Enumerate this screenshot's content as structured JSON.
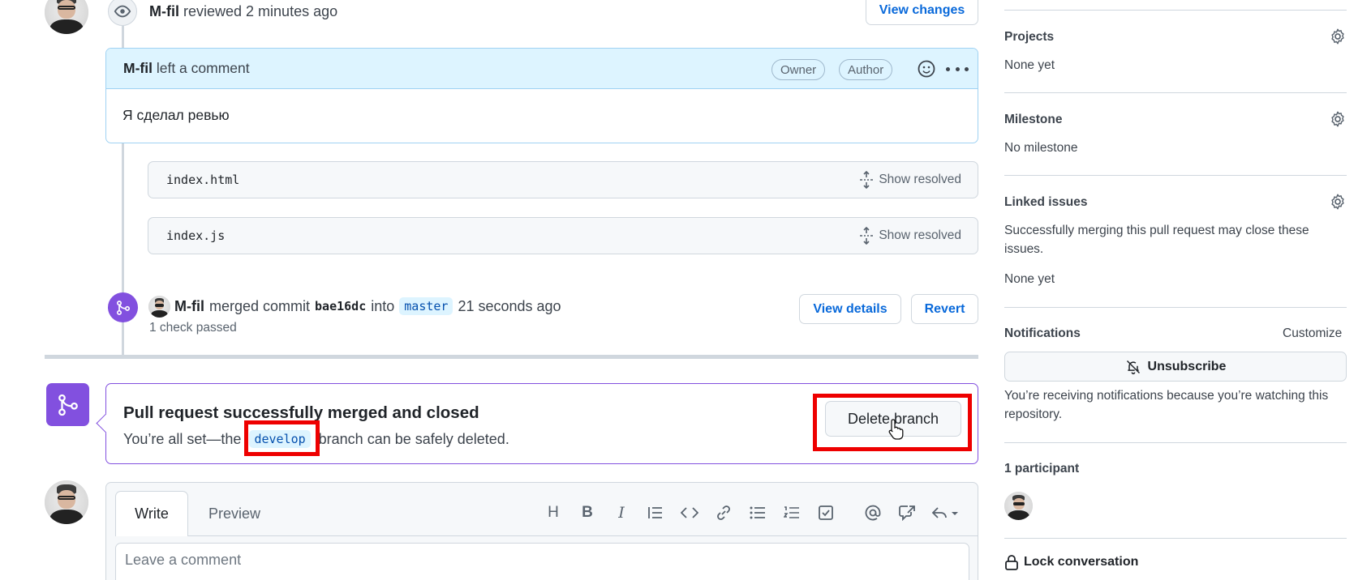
{
  "review_event": {
    "author": "M-fil",
    "action": "reviewed 2 minutes ago",
    "view_changes": "View changes"
  },
  "comment": {
    "author": "M-fil",
    "action": "left a comment",
    "badges": [
      "Owner",
      "Author"
    ],
    "body": "Я сделал ревью"
  },
  "files": [
    {
      "name": "index.html",
      "action": "Show resolved"
    },
    {
      "name": "index.js",
      "action": "Show resolved"
    }
  ],
  "merge_event": {
    "author": "M-fil",
    "verb": "merged commit",
    "commit": "bae16dc",
    "into": "into",
    "branch": "master",
    "time": "21 seconds ago",
    "checks": "1 check passed",
    "view_details": "View details",
    "revert": "Revert"
  },
  "merged_box": {
    "title": "Pull request successfully merged and closed",
    "text_before": "You’re all set—the",
    "branch": "develop",
    "text_after": "branch can be safely deleted.",
    "delete_button": "Delete branch"
  },
  "editor": {
    "tab_write": "Write",
    "tab_preview": "Preview",
    "placeholder": "Leave a comment",
    "tools": [
      "heading-icon",
      "bold-icon",
      "italic-icon",
      "quote-icon",
      "code-icon",
      "link-icon",
      "unordered-list-icon",
      "ordered-list-icon",
      "task-list-icon",
      "mention-icon",
      "cross-reference-icon",
      "reply-icon"
    ]
  },
  "sidebar": {
    "projects_title": "Projects",
    "projects_value": "None yet",
    "milestone_title": "Milestone",
    "milestone_value": "No milestone",
    "linked_title": "Linked issues",
    "linked_text": "Successfully merging this pull request may close these issues.",
    "linked_value": "None yet",
    "notifications_title": "Notifications",
    "customize": "Customize",
    "unsubscribe": "Unsubscribe",
    "notif_text": "You’re receiving notifications because you’re watching this repository.",
    "participants": "1 participant",
    "lock": "Lock conversation"
  },
  "colors": {
    "accent": "#0969da",
    "merged": "#8250df",
    "highlight": "#ee0000"
  }
}
